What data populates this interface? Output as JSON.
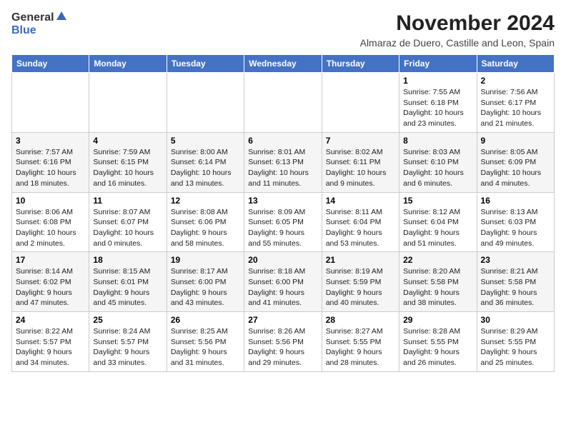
{
  "logo": {
    "general": "General",
    "blue": "Blue"
  },
  "title": "November 2024",
  "subtitle": "Almaraz de Duero, Castille and Leon, Spain",
  "headers": [
    "Sunday",
    "Monday",
    "Tuesday",
    "Wednesday",
    "Thursday",
    "Friday",
    "Saturday"
  ],
  "weeks": [
    [
      {
        "day": "",
        "info": ""
      },
      {
        "day": "",
        "info": ""
      },
      {
        "day": "",
        "info": ""
      },
      {
        "day": "",
        "info": ""
      },
      {
        "day": "",
        "info": ""
      },
      {
        "day": "1",
        "info": "Sunrise: 7:55 AM\nSunset: 6:18 PM\nDaylight: 10 hours and 23 minutes."
      },
      {
        "day": "2",
        "info": "Sunrise: 7:56 AM\nSunset: 6:17 PM\nDaylight: 10 hours and 21 minutes."
      }
    ],
    [
      {
        "day": "3",
        "info": "Sunrise: 7:57 AM\nSunset: 6:16 PM\nDaylight: 10 hours and 18 minutes."
      },
      {
        "day": "4",
        "info": "Sunrise: 7:59 AM\nSunset: 6:15 PM\nDaylight: 10 hours and 16 minutes."
      },
      {
        "day": "5",
        "info": "Sunrise: 8:00 AM\nSunset: 6:14 PM\nDaylight: 10 hours and 13 minutes."
      },
      {
        "day": "6",
        "info": "Sunrise: 8:01 AM\nSunset: 6:13 PM\nDaylight: 10 hours and 11 minutes."
      },
      {
        "day": "7",
        "info": "Sunrise: 8:02 AM\nSunset: 6:11 PM\nDaylight: 10 hours and 9 minutes."
      },
      {
        "day": "8",
        "info": "Sunrise: 8:03 AM\nSunset: 6:10 PM\nDaylight: 10 hours and 6 minutes."
      },
      {
        "day": "9",
        "info": "Sunrise: 8:05 AM\nSunset: 6:09 PM\nDaylight: 10 hours and 4 minutes."
      }
    ],
    [
      {
        "day": "10",
        "info": "Sunrise: 8:06 AM\nSunset: 6:08 PM\nDaylight: 10 hours and 2 minutes."
      },
      {
        "day": "11",
        "info": "Sunrise: 8:07 AM\nSunset: 6:07 PM\nDaylight: 10 hours and 0 minutes."
      },
      {
        "day": "12",
        "info": "Sunrise: 8:08 AM\nSunset: 6:06 PM\nDaylight: 9 hours and 58 minutes."
      },
      {
        "day": "13",
        "info": "Sunrise: 8:09 AM\nSunset: 6:05 PM\nDaylight: 9 hours and 55 minutes."
      },
      {
        "day": "14",
        "info": "Sunrise: 8:11 AM\nSunset: 6:04 PM\nDaylight: 9 hours and 53 minutes."
      },
      {
        "day": "15",
        "info": "Sunrise: 8:12 AM\nSunset: 6:04 PM\nDaylight: 9 hours and 51 minutes."
      },
      {
        "day": "16",
        "info": "Sunrise: 8:13 AM\nSunset: 6:03 PM\nDaylight: 9 hours and 49 minutes."
      }
    ],
    [
      {
        "day": "17",
        "info": "Sunrise: 8:14 AM\nSunset: 6:02 PM\nDaylight: 9 hours and 47 minutes."
      },
      {
        "day": "18",
        "info": "Sunrise: 8:15 AM\nSunset: 6:01 PM\nDaylight: 9 hours and 45 minutes."
      },
      {
        "day": "19",
        "info": "Sunrise: 8:17 AM\nSunset: 6:00 PM\nDaylight: 9 hours and 43 minutes."
      },
      {
        "day": "20",
        "info": "Sunrise: 8:18 AM\nSunset: 6:00 PM\nDaylight: 9 hours and 41 minutes."
      },
      {
        "day": "21",
        "info": "Sunrise: 8:19 AM\nSunset: 5:59 PM\nDaylight: 9 hours and 40 minutes."
      },
      {
        "day": "22",
        "info": "Sunrise: 8:20 AM\nSunset: 5:58 PM\nDaylight: 9 hours and 38 minutes."
      },
      {
        "day": "23",
        "info": "Sunrise: 8:21 AM\nSunset: 5:58 PM\nDaylight: 9 hours and 36 minutes."
      }
    ],
    [
      {
        "day": "24",
        "info": "Sunrise: 8:22 AM\nSunset: 5:57 PM\nDaylight: 9 hours and 34 minutes."
      },
      {
        "day": "25",
        "info": "Sunrise: 8:24 AM\nSunset: 5:57 PM\nDaylight: 9 hours and 33 minutes."
      },
      {
        "day": "26",
        "info": "Sunrise: 8:25 AM\nSunset: 5:56 PM\nDaylight: 9 hours and 31 minutes."
      },
      {
        "day": "27",
        "info": "Sunrise: 8:26 AM\nSunset: 5:56 PM\nDaylight: 9 hours and 29 minutes."
      },
      {
        "day": "28",
        "info": "Sunrise: 8:27 AM\nSunset: 5:55 PM\nDaylight: 9 hours and 28 minutes."
      },
      {
        "day": "29",
        "info": "Sunrise: 8:28 AM\nSunset: 5:55 PM\nDaylight: 9 hours and 26 minutes."
      },
      {
        "day": "30",
        "info": "Sunrise: 8:29 AM\nSunset: 5:55 PM\nDaylight: 9 hours and 25 minutes."
      }
    ]
  ]
}
